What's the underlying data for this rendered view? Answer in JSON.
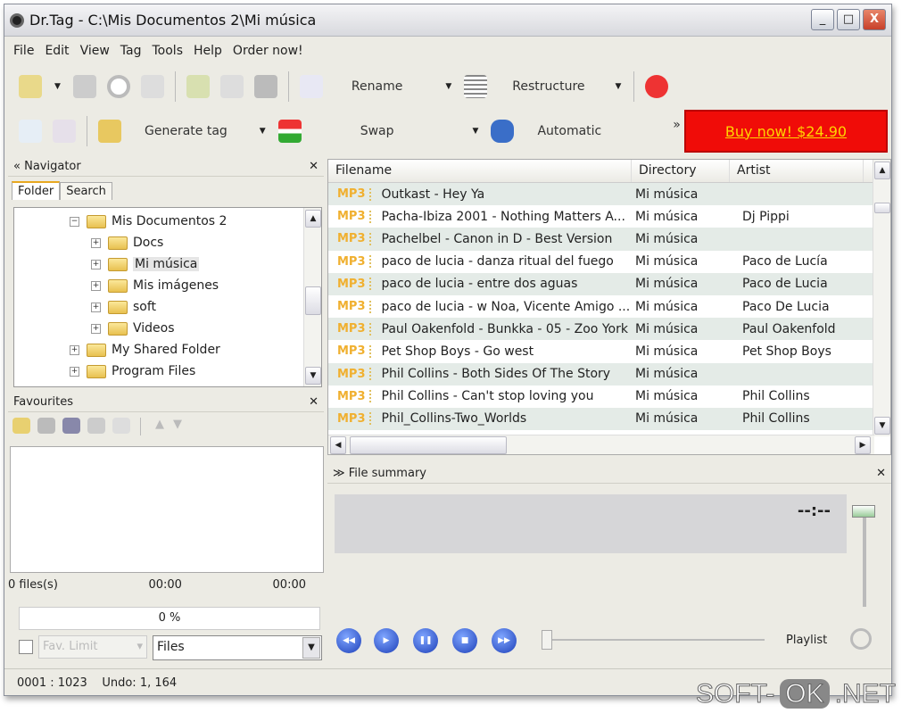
{
  "window": {
    "title": "Dr.Tag - C:\\Mis Documentos 2\\Mi música"
  },
  "menu": [
    "File",
    "Edit",
    "View",
    "Tag",
    "Tools",
    "Help",
    "Order now!"
  ],
  "toolbar": {
    "rename": "Rename",
    "restructure": "Restructure",
    "generate_tag": "Generate tag",
    "swap": "Swap",
    "automatic": "Automatic",
    "overflow": "»",
    "buy": "Buy now! $24.90"
  },
  "navigator": {
    "title": "Navigator",
    "tabs": [
      "Folder",
      "Search"
    ],
    "tree": [
      {
        "label": "Mis Documentos 2",
        "level": 0,
        "expander": "−"
      },
      {
        "label": "Docs",
        "level": 1,
        "expander": "+"
      },
      {
        "label": "Mi música",
        "level": 1,
        "expander": "+",
        "selected": true
      },
      {
        "label": "Mis imágenes",
        "level": 1,
        "expander": "+"
      },
      {
        "label": "soft",
        "level": 1,
        "expander": "+"
      },
      {
        "label": "Videos",
        "level": 1,
        "expander": "+"
      },
      {
        "label": "My Shared Folder",
        "level": 0,
        "expander": "+"
      },
      {
        "label": "Program Files",
        "level": 0,
        "expander": "+"
      }
    ]
  },
  "favourites": {
    "title": "Favourites",
    "files": "0 files(s)",
    "time1": "00:00",
    "time2": "00:00",
    "progress": "0 %",
    "fav_limit": "Fav. Limit",
    "filter": "Files"
  },
  "table": {
    "columns": [
      "Filename",
      "Directory",
      "Artist"
    ],
    "rows": [
      {
        "type": "MP3",
        "file": "Outkast - Hey Ya",
        "dir": "Mi música",
        "artist": ""
      },
      {
        "type": "MP3",
        "file": "Pacha-Ibiza 2001 - Nothing Matters A...",
        "dir": "Mi música",
        "artist": "Dj Pippi"
      },
      {
        "type": "MP3",
        "file": "Pachelbel - Canon in D - Best Version",
        "dir": "Mi música",
        "artist": ""
      },
      {
        "type": "MP3",
        "file": "paco de lucia - danza ritual del fuego",
        "dir": "Mi música",
        "artist": "Paco de Lucía"
      },
      {
        "type": "MP3",
        "file": "paco de lucia - entre dos aguas",
        "dir": "Mi música",
        "artist": "Paco de Lucia"
      },
      {
        "type": "MP3",
        "file": "paco de lucia - w Noa, Vicente Amigo ...",
        "dir": "Mi música",
        "artist": "Paco De Lucia"
      },
      {
        "type": "MP3",
        "file": "Paul Oakenfold - Bunkka - 05 - Zoo York",
        "dir": "Mi música",
        "artist": "Paul Oakenfold"
      },
      {
        "type": "MP3",
        "file": "Pet Shop Boys - Go west",
        "dir": "Mi música",
        "artist": "Pet Shop Boys"
      },
      {
        "type": "MP3",
        "file": "Phil Collins - Both Sides Of The Story",
        "dir": "Mi música",
        "artist": ""
      },
      {
        "type": "MP3",
        "file": "Phil Collins - Can't stop loving you",
        "dir": "Mi música",
        "artist": "Phil Collins"
      },
      {
        "type": "MP3",
        "file": "Phil_Collins-Two_Worlds",
        "dir": "Mi música",
        "artist": "Phil Collins"
      }
    ]
  },
  "summary": {
    "title": "File summary",
    "time": "--:--",
    "playlist": "Playlist"
  },
  "status": {
    "position": "0001 : 1023",
    "undo": "Undo: 1, 164"
  },
  "watermark": {
    "a": "SOFT-",
    "b": "OK",
    ".c": "",
    "c": ".NET"
  }
}
